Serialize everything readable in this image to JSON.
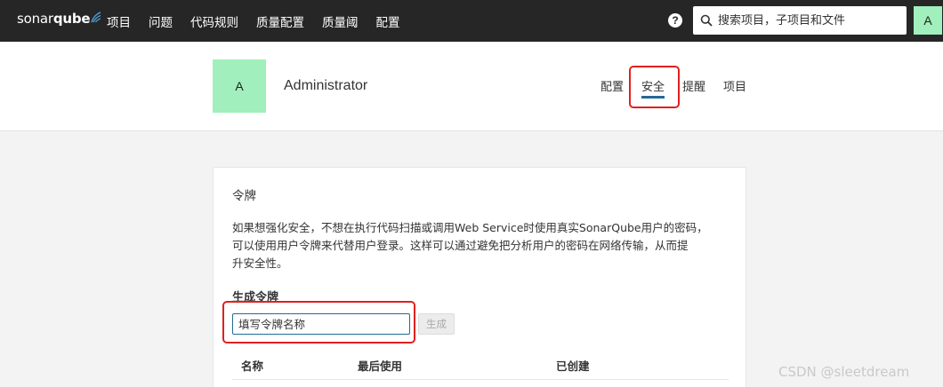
{
  "topnav": {
    "logo_part1": "sonar",
    "logo_part2": "qube",
    "links": [
      "项目",
      "问题",
      "代码规则",
      "质量配置",
      "质量阈",
      "配置"
    ],
    "help_label": "?",
    "search_placeholder": "搜索项目，子项目和文件",
    "avatar_letter": "A",
    "avatar_color": "#a0efbc",
    "bg_color": "#262626"
  },
  "account": {
    "avatar_letter": "A",
    "name": "Administrator",
    "tabs": [
      {
        "label": "配置",
        "active": false
      },
      {
        "label": "安全",
        "active": true
      },
      {
        "label": "提醒",
        "active": false
      },
      {
        "label": "项目",
        "active": false
      }
    ],
    "active_tab_color": "#236a97"
  },
  "tokens": {
    "title": "令牌",
    "description_lines": [
      "如果想强化安全，不想在执行代码扫描或调用Web Service时使用真实SonarQube用户的密码，",
      "可以使用用户令牌来代替用户登录。这样可以通过避免把分析用户的密码在网络传输，从而提",
      "升安全性。"
    ],
    "generate_title": "生成令牌",
    "input_placeholder": "填写令牌名称",
    "generate_button": "生成",
    "columns": [
      "名称",
      "最后使用",
      "已创建"
    ]
  },
  "highlight_color": "#e02020",
  "watermark": "CSDN @sleetdream"
}
